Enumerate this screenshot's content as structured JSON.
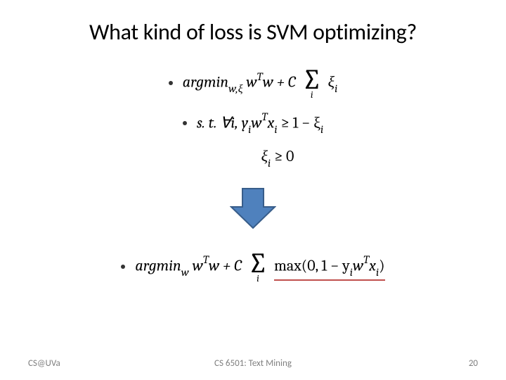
{
  "title": "What kind of loss is SVM optimizing?",
  "formula1": {
    "argmin_prefix": "argmin",
    "argmin_sub": "w,ξ",
    "lhs": "w",
    "lhs_sup": "T",
    "lhs2": "w + C",
    "sum_idx": "i",
    "xi": "ξ",
    "xi_sub": "i"
  },
  "constraint1": {
    "st": "s. t.  ∀i,  y",
    "yi_sub": "i",
    "w": "w",
    "wT": "T",
    "x": "x",
    "xi_sub": "i",
    "geq": " ≥ 1 − ξ",
    "xi_sub2": "i"
  },
  "constraint2": {
    "xi": "ξ",
    "xi_sub": "i",
    "geq": " ≥ 0"
  },
  "formula2": {
    "argmin_prefix": "argmin",
    "argmin_sub": "w",
    "lhs": "w",
    "lhs_sup": "T",
    "lhs2": "w + C",
    "sum_idx": "i",
    "max_prefix": "max(0, 1 − y",
    "yi_sub": "i",
    "w": "w",
    "wT": "T",
    "x": "x",
    "xi_sub": "i",
    "max_suffix": ")"
  },
  "arrow": {
    "fill": "#4f81bd",
    "stroke": "#385d8a"
  },
  "footer": {
    "left": "CS@UVa",
    "mid": "CS 6501: Text Mining",
    "right": "20"
  }
}
